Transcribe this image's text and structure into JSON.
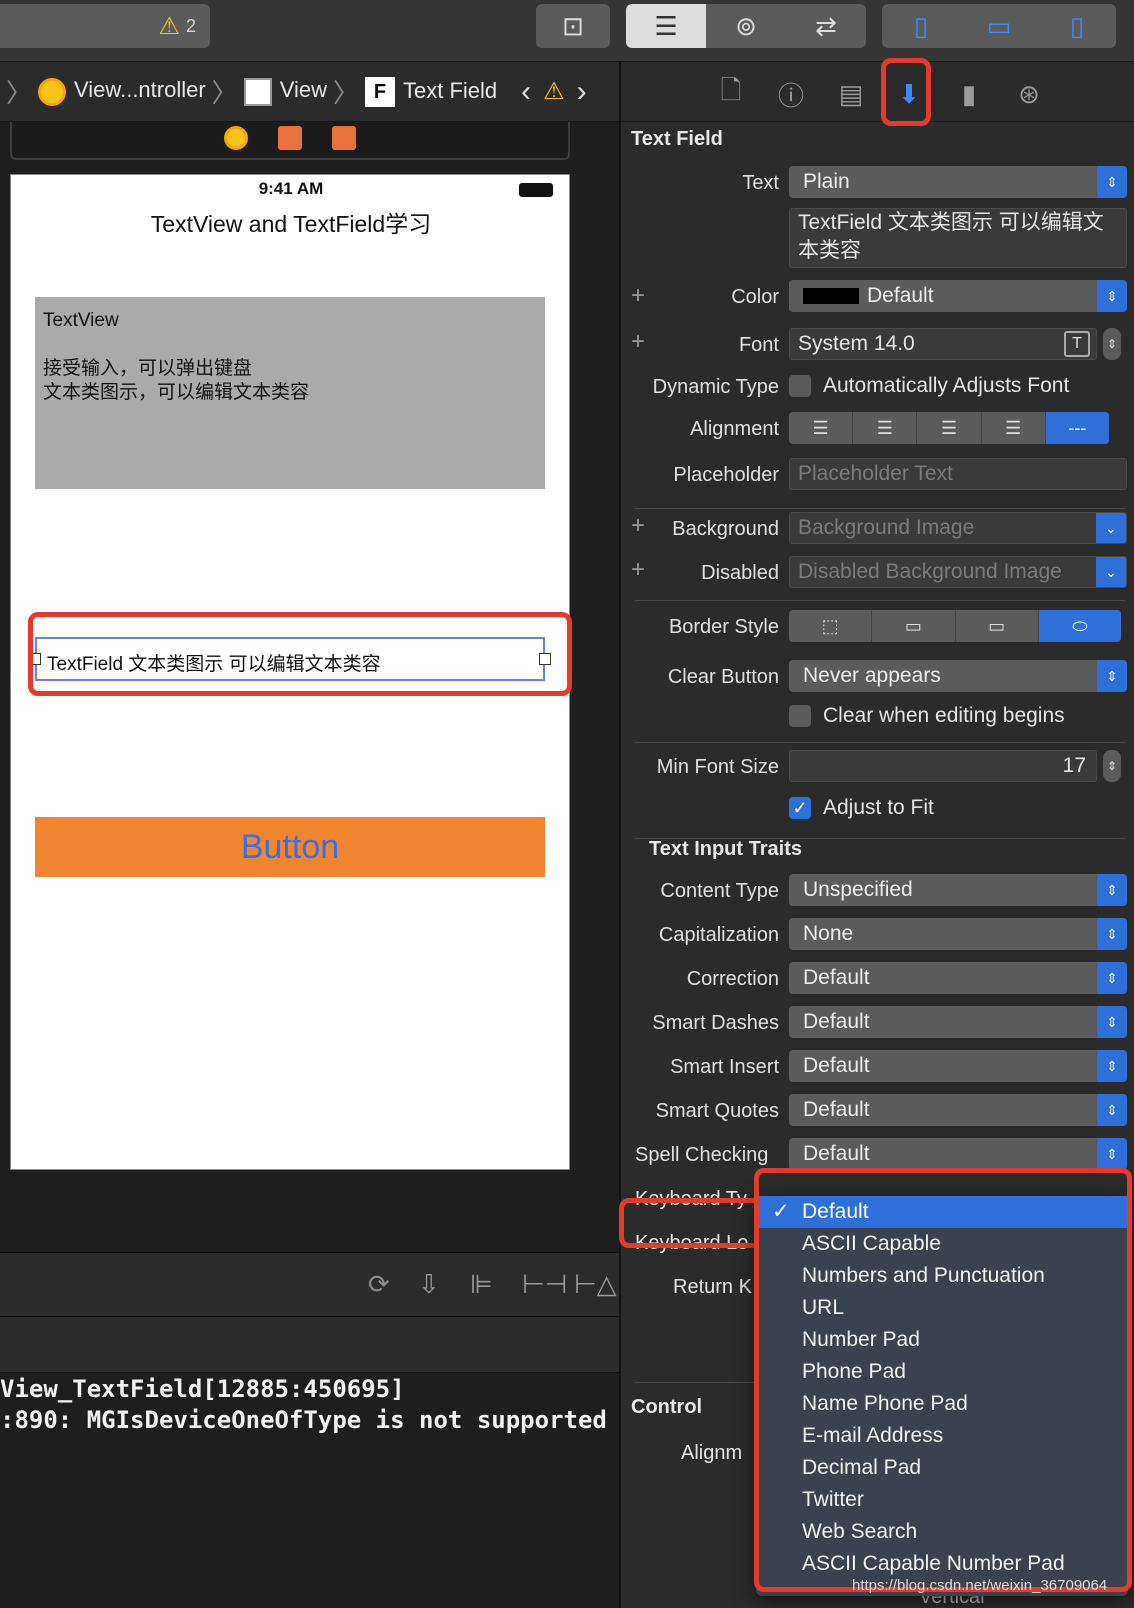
{
  "toolbar": {
    "warning_count": "2"
  },
  "jumpbar": {
    "items": [
      "View...ntroller",
      "View",
      "Text Field"
    ]
  },
  "phone": {
    "time": "9:41 AM",
    "title": "TextView and TextField学习",
    "textview_lines": [
      "TextView",
      "",
      "接受输入，可以弹出键盘",
      "文本类图示，可以编辑文本类容"
    ],
    "textfield_text": "TextField 文本类图示 可以编辑文本类容",
    "button_label": "Button"
  },
  "console": {
    "lines": [
      "View_TextField[12885:450695]",
      ":890: MGIsDeviceOneOfType is not supported"
    ]
  },
  "inspector": {
    "section_title": "Text Field",
    "text_label": "Text",
    "text_value": "Plain",
    "text_content": "TextField 文本类图示 可以编辑文本类容",
    "color_label": "Color",
    "color_value": "Default",
    "font_label": "Font",
    "font_value": "System 14.0",
    "dynamic_type_label": "Dynamic Type",
    "dynamic_type_value": "Automatically Adjusts Font",
    "alignment_label": "Alignment",
    "placeholder_label": "Placeholder",
    "placeholder_hint": "Placeholder Text",
    "background_label": "Background",
    "background_hint": "Background Image",
    "disabled_label": "Disabled",
    "disabled_hint": "Disabled Background Image",
    "border_style_label": "Border Style",
    "clear_button_label": "Clear Button",
    "clear_button_value": "Never appears",
    "clear_editing_label": "Clear when editing begins",
    "min_font_label": "Min Font Size",
    "min_font_value": "17",
    "adjust_fit_label": "Adjust to Fit",
    "traits_title": "Text Input Traits",
    "content_type_label": "Content Type",
    "content_type_value": "Unspecified",
    "capitalization_label": "Capitalization",
    "capitalization_value": "None",
    "correction_label": "Correction",
    "correction_value": "Default",
    "smart_dashes_label": "Smart Dashes",
    "smart_dashes_value": "Default",
    "smart_insert_label": "Smart Insert",
    "smart_insert_value": "Default",
    "smart_quotes_label": "Smart Quotes",
    "smart_quotes_value": "Default",
    "spell_checking_label": "Spell Checking",
    "spell_checking_value": "Default",
    "keyboard_type_label": "Keyboard Ty",
    "keyboard_look_label": "Keyboard Lo",
    "return_key_label": "Return K",
    "control_title": "Control",
    "control_align_label": "Alignm",
    "vertical_label": "Vertical"
  },
  "keyboard_menu": {
    "selected": "Default",
    "items": [
      "Default",
      "ASCII Capable",
      "Numbers and Punctuation",
      "URL",
      "Number Pad",
      "Phone Pad",
      "Name Phone Pad",
      "E-mail Address",
      "Decimal Pad",
      "Twitter",
      "Web Search",
      "ASCII Capable Number Pad"
    ]
  },
  "watermark": "https://blog.csdn.net/weixin_36709064",
  "colors": {
    "accent": "#2e6fd8",
    "highlight": "#e53b2c",
    "button_bg": "#ef8530",
    "button_text": "#3b6fe0"
  }
}
